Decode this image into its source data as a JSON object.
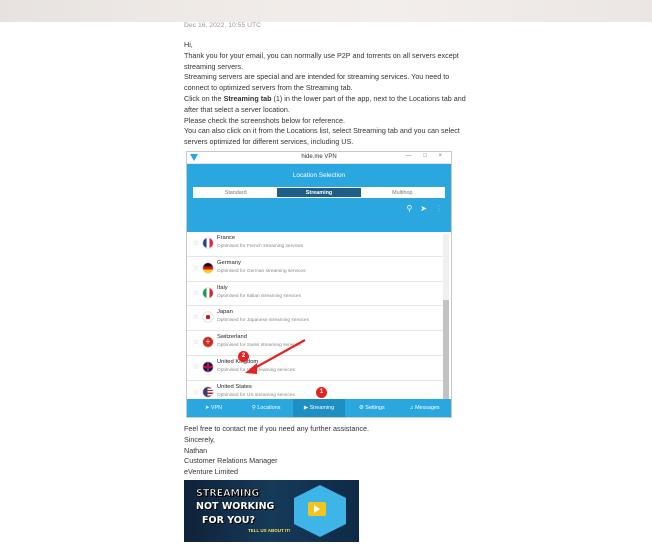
{
  "email": {
    "date": "Dec 16, 2022, 10:55 UTC",
    "greeting": "Hi,",
    "para1": "Thank you for your email, you can normally use P2P and torrents on all servers except streaming servers.",
    "para2": "Streaming servers are special and are intended for streaming services. You need to connect to optimized servers from the Streaming tab.",
    "para3_pre": "Click on the ",
    "para3_bold": "Streaming tab",
    "para3_post": " (1) in the lower part of the app, next to the Locations tab and after that select a server location.",
    "para4": "Please check the screenshots below for reference.",
    "para5": "You can also click on it from the Locations list, select Streaming tab and you can select servers optimized for different services, including US."
  },
  "screenshot": {
    "window_title": "hide.me VPN",
    "window_controls": "— □ ×",
    "header_title": "Location Selection",
    "tabs": [
      "Standard",
      "Streaming",
      "Multihop"
    ],
    "active_tab": "Streaming",
    "locations": [
      {
        "name": "France",
        "desc": "Optimised for French streaming services",
        "flag": "fr"
      },
      {
        "name": "Germany",
        "desc": "Optimised for German streaming services",
        "flag": "de"
      },
      {
        "name": "Italy",
        "desc": "Optimised for Italian streaming services",
        "flag": "it"
      },
      {
        "name": "Japan",
        "desc": "Optimised for Japanese streaming services",
        "flag": "jp"
      },
      {
        "name": "Switzerland",
        "desc": "Optimised for Swiss streaming services",
        "flag": "ch"
      },
      {
        "name": "United Kingdom",
        "desc": "Optimised for UK streaming services",
        "flag": "gb"
      },
      {
        "name": "United States",
        "desc": "Optimised for US streaming services",
        "flag": "us"
      }
    ],
    "bottom_nav": [
      {
        "label": "VPN",
        "icon": "vpn-icon"
      },
      {
        "label": "Locations",
        "icon": "location-pin-icon"
      },
      {
        "label": "Streaming",
        "icon": "play-circle-icon"
      },
      {
        "label": "Settings",
        "icon": "gear-icon"
      },
      {
        "label": "Messages",
        "icon": "bell-icon"
      }
    ],
    "badge1": "1",
    "badge2": "2",
    "annotation_color": "#e52222",
    "accent_color": "#2aa7df"
  },
  "footer": {
    "line1": "Feel free to contact me if you need any further assistance.",
    "line2": "Sincerely,",
    "line3": "Nathan",
    "line4": "Customer Relations Manager",
    "line5": "eVenture Limited"
  },
  "banner": {
    "line1": "STREAMING",
    "line2": "NOT WORKING",
    "line3": "FOR YOU?",
    "line4": "TELL US ABOUT IT!"
  }
}
